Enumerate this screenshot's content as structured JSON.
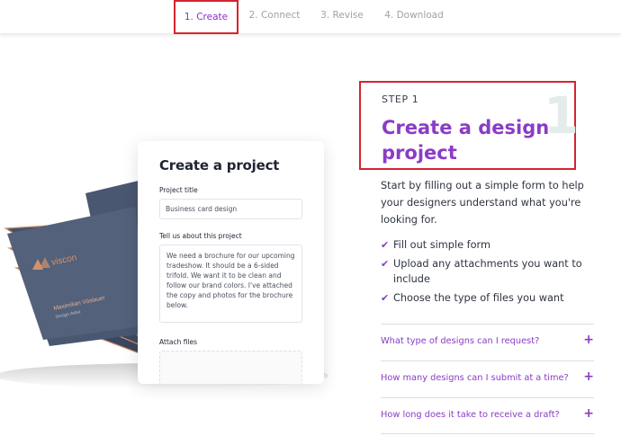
{
  "nav": {
    "tabs": [
      {
        "label": "1. Create",
        "active": true
      },
      {
        "label": "2. Connect",
        "active": false
      },
      {
        "label": "3. Revise",
        "active": false
      },
      {
        "label": "4. Download",
        "active": false
      }
    ]
  },
  "form_card": {
    "title": "Create a project",
    "project_title_label": "Project title",
    "project_title_value": "Business card design",
    "about_label": "Tell us about this project",
    "about_value": "We need a brochure for our upcoming tradeshow. It should be a 6-sided trifold. We want it to be clean and follow our brand colors. I've attached the copy and photos for the brochure below.",
    "attach_label": "Attach files"
  },
  "business_card": {
    "brand": "viscon",
    "name": "Maximilian Vöslauer",
    "role": "Design Artist"
  },
  "step": {
    "label": "STEP 1",
    "number": "1",
    "title": "Create a design project",
    "intro": "Start by filling out a simple form to help your designers understand what you're looking for.",
    "checklist": [
      "Fill out simple form",
      "Upload any attachments you want to include",
      "Choose the type of files you want"
    ]
  },
  "faq": [
    {
      "question": "What type of designs can I request?"
    },
    {
      "question": "How many designs can I submit at a time?"
    },
    {
      "question": "How long does it take to receive a draft?"
    }
  ],
  "colors": {
    "accent": "#8a3cc6",
    "highlight_box": "#d6232f",
    "card_navy": "#3c4a63",
    "card_copper": "#d3916a"
  }
}
